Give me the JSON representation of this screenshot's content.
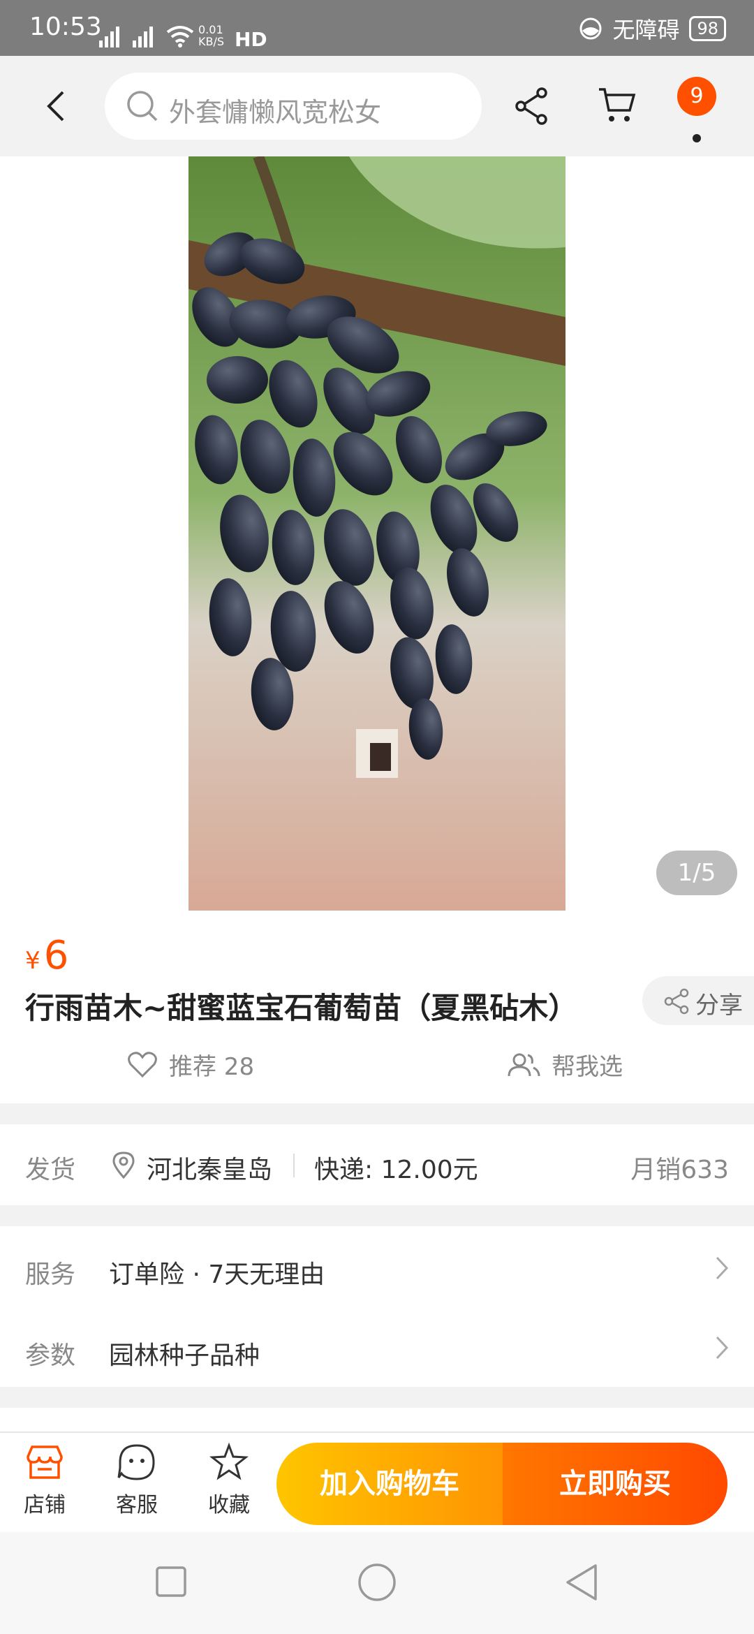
{
  "status_bar": {
    "time": "10:53",
    "net_speed": "0.01\nKB/S",
    "accessibility": "无障碍",
    "battery": "98"
  },
  "nav": {
    "search_placeholder": "外套慵懒风宽松女",
    "badge_count": "9"
  },
  "gallery": {
    "pager": "1/5"
  },
  "product": {
    "currency": "¥",
    "price": "6",
    "title": "行雨苗木~甜蜜蓝宝石葡萄苗（夏黑砧木）",
    "share_label": "分享",
    "recommend_label": "推荐 28",
    "help_choose_label": "帮我选"
  },
  "shipping": {
    "label": "发货",
    "location": "河北秦皇岛",
    "express": "快递: 12.00元",
    "monthly_sales": "月销633"
  },
  "service": {
    "label": "服务",
    "value": "订单险 · 7天无理由"
  },
  "params": {
    "label": "参数",
    "value": "园林种子品种"
  },
  "bottom_bar": {
    "shop": "店铺",
    "service": "客服",
    "favorite": "收藏",
    "add_to_cart": "加入购物车",
    "buy_now": "立即购买"
  },
  "colors": {
    "accent": "#ff5000",
    "cart_gradient": [
      "#ffc500",
      "#ff9402"
    ],
    "buy_gradient": [
      "#ff7700",
      "#ff4900"
    ]
  }
}
